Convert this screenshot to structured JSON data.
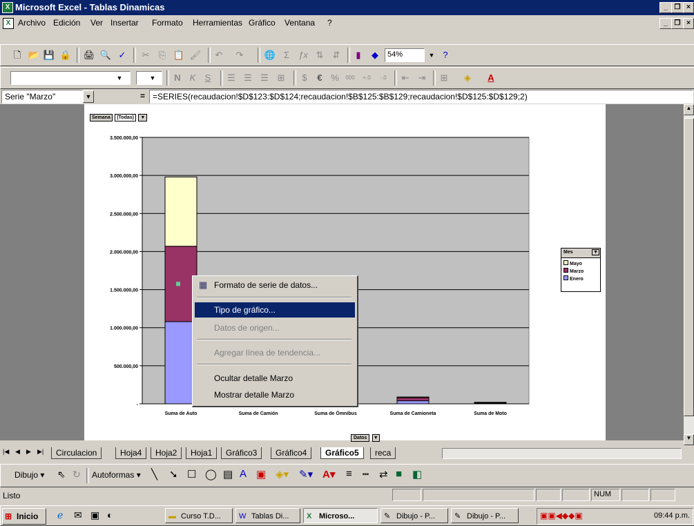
{
  "window": {
    "title": "Microsoft Excel - Tablas Dinamicas"
  },
  "menu": [
    "Archivo",
    "Edición",
    "Ver",
    "Insertar",
    "Formato",
    "Herramientas",
    "Gráfico",
    "Ventana",
    "?"
  ],
  "toolbar": {
    "zoom": "54%"
  },
  "formula": {
    "namebox": "Serie \"Marzo\"",
    "equals": "=",
    "content": "=SERIES(recaudacion!$D$123:$D$124;recaudacion!$B$125:$B$129;recaudacion!$D$125:$D$129;2)"
  },
  "pivot": {
    "page_field": "Semana",
    "page_value": "(Todas)",
    "data_button": "Datos",
    "legend_field": "Mes"
  },
  "chart_data": {
    "type": "bar",
    "stacked": true,
    "categories": [
      "Suma de Auto",
      "Suma de Camión",
      "Suma de Ómnibus",
      "Suma de Camioneta",
      "Suma de Moto"
    ],
    "series": [
      {
        "name": "Enero",
        "values": [
          1080000,
          0,
          30000,
          40000,
          5000
        ],
        "color": "#9999ff"
      },
      {
        "name": "Marzo",
        "values": [
          990000,
          0,
          40000,
          40000,
          10000
        ],
        "color": "#993366"
      },
      {
        "name": "Mayo",
        "values": [
          910000,
          0,
          30000,
          10000,
          5000
        ],
        "color": "#ffffcc"
      }
    ],
    "yticks": [
      "3.500.000,00",
      "3.000.000,00",
      "2.500.000,00",
      "2.000.000,00",
      "1.500.000,00",
      "1.000.000,00",
      "500.000,00",
      "-"
    ],
    "ylim": [
      0,
      3500000
    ],
    "grid": true,
    "legend": "right",
    "legend_entries": [
      "Mayo",
      "Marzo",
      "Enero"
    ]
  },
  "context_menu": {
    "format_series": "Formato de serie de datos...",
    "chart_type": "Tipo de gráfico...",
    "source_data": "Datos de origen...",
    "add_trendline": "Agregar línea de tendencia...",
    "hide_detail": "Ocultar detalle Marzo",
    "show_detail": "Mostrar detalle Marzo"
  },
  "sheet_tabs": [
    "Circulacion",
    "Hoja4",
    "Hoja2",
    "Hoja1",
    "Gráfico3",
    "Gráfico4",
    "Gráfico5",
    "reca"
  ],
  "drawing": {
    "draw": "Dibujo",
    "autoshapes": "Autoformas"
  },
  "status": {
    "ready": "Listo",
    "num": "NUM"
  },
  "taskbar": {
    "start": "Inicio",
    "items": [
      "Curso T.D...",
      "Tablas Di...",
      "Microso...",
      "Dibujo - P...",
      "Dibujo - P..."
    ],
    "time": "09:44 p.m."
  }
}
